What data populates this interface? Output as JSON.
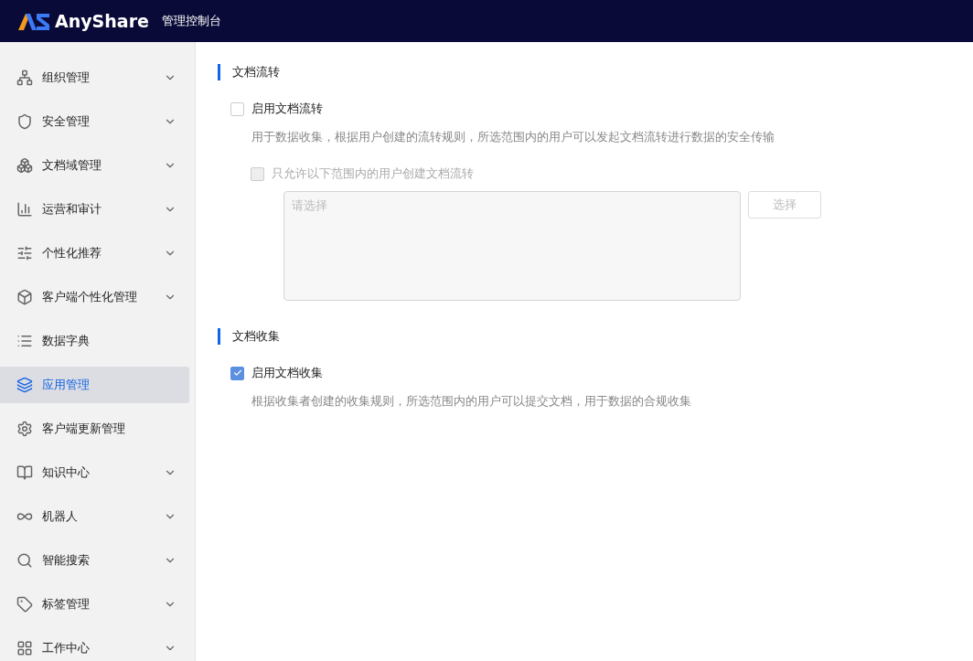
{
  "header": {
    "brand": "AnyShare",
    "title": "管理控制台"
  },
  "sidebar": {
    "items": [
      {
        "label": "组织管理",
        "expandable": true,
        "selected": false
      },
      {
        "label": "安全管理",
        "expandable": true,
        "selected": false
      },
      {
        "label": "文档域管理",
        "expandable": true,
        "selected": false
      },
      {
        "label": "运营和审计",
        "expandable": true,
        "selected": false
      },
      {
        "label": "个性化推荐",
        "expandable": true,
        "selected": false
      },
      {
        "label": "客户端个性化管理",
        "expandable": true,
        "selected": false
      },
      {
        "label": "数据字典",
        "expandable": false,
        "selected": false
      },
      {
        "label": "应用管理",
        "expandable": false,
        "selected": true
      },
      {
        "label": "客户端更新管理",
        "expandable": false,
        "selected": false
      },
      {
        "label": "知识中心",
        "expandable": true,
        "selected": false
      },
      {
        "label": "机器人",
        "expandable": true,
        "selected": false
      },
      {
        "label": "智能搜索",
        "expandable": true,
        "selected": false
      },
      {
        "label": "标签管理",
        "expandable": true,
        "selected": false
      },
      {
        "label": "工作中心",
        "expandable": true,
        "selected": false
      }
    ]
  },
  "sections": [
    {
      "title": "文档流转",
      "option": {
        "label": "启用文档流转",
        "checked": false
      },
      "description": "用于数据收集，根据用户创建的流转规则，所选范围内的用户可以发起文档流转进行数据的安全传输",
      "restriction": {
        "label": "只允许以下范围内的用户创建文档流转",
        "checked": false,
        "disabled": true,
        "placeholder": "请选择",
        "button": "选择"
      }
    },
    {
      "title": "文档收集",
      "option": {
        "label": "启用文档收集",
        "checked": true
      },
      "description": "根据收集者创建的收集规则，所选范围内的用户可以提交文档，用于数据的合规收集"
    }
  ]
}
